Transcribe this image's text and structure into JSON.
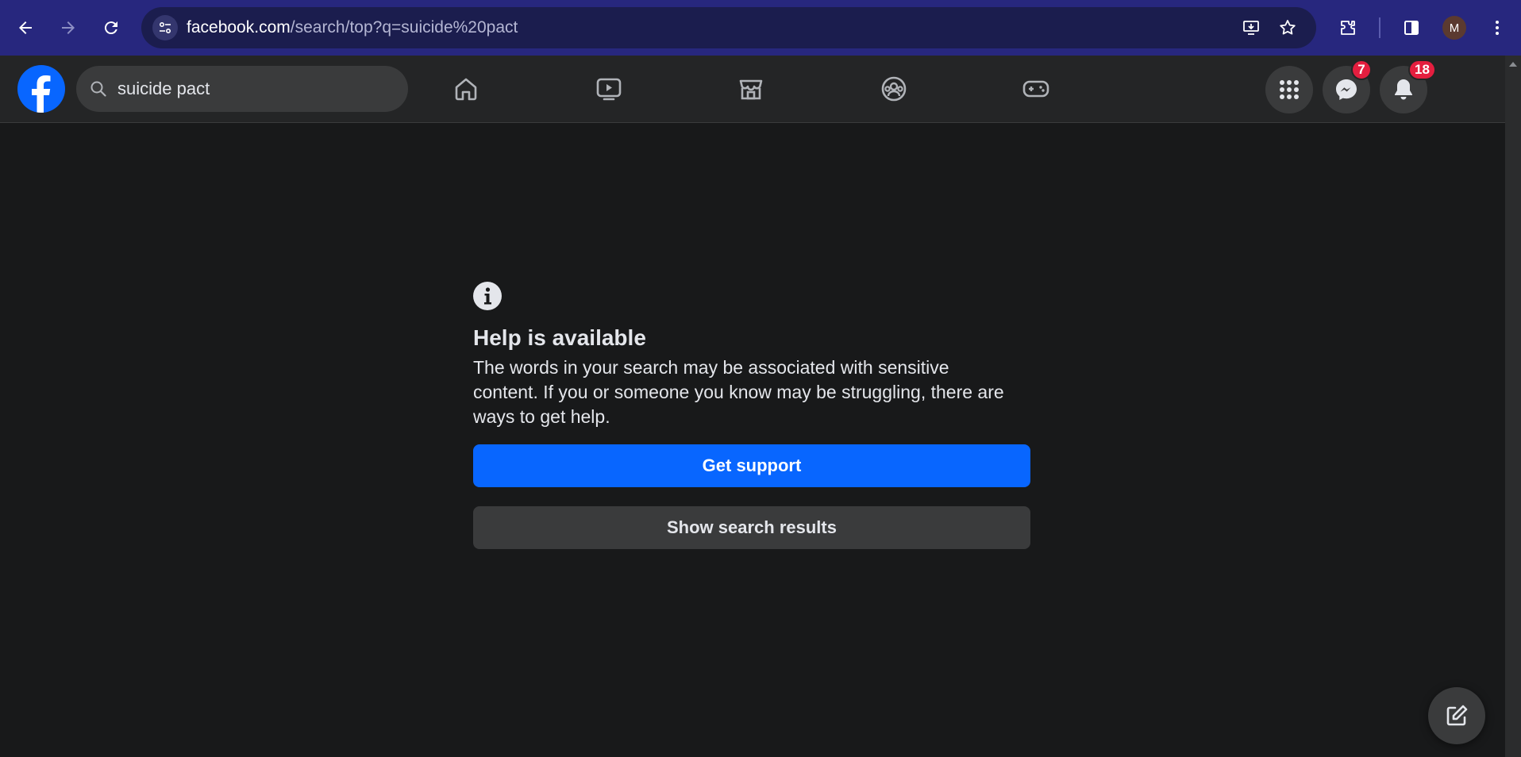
{
  "browser": {
    "url_domain": "facebook.com",
    "url_path": "/search/top?q=suicide%20pact",
    "profile_initial": "M"
  },
  "header": {
    "search_value": "suicide pact",
    "messenger_badge": "7",
    "notifications_badge": "18"
  },
  "main": {
    "title": "Help is available",
    "body": "The words in your search may be associated with sensitive content. If you or someone you know may be struggling, there are ways to get help.",
    "primary_button": "Get support",
    "secondary_button": "Show search results"
  },
  "colors": {
    "chrome": "#27277e",
    "fb_blue": "#0866ff",
    "badge_red": "#e41e3f",
    "page_bg": "#18191a"
  },
  "icons": {
    "nav": [
      "home-icon",
      "video-icon",
      "marketplace-icon",
      "groups-icon",
      "gaming-icon"
    ],
    "actions": [
      "menu-grid-icon",
      "messenger-icon",
      "bell-icon"
    ],
    "info": "info-icon",
    "compose": "compose-icon"
  }
}
